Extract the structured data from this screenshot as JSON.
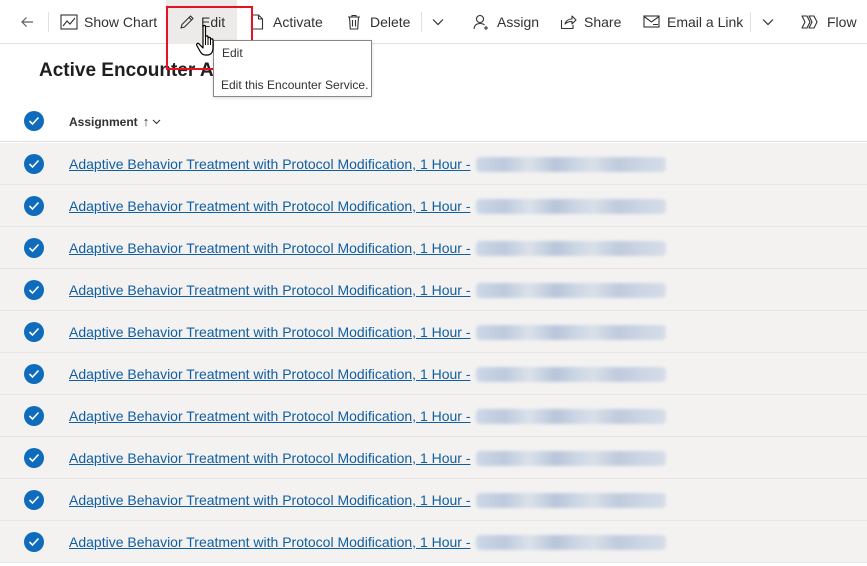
{
  "toolbar": {
    "show_chart": "Show Chart",
    "edit": "Edit",
    "activate": "Activate",
    "delete": "Delete",
    "assign": "Assign",
    "share": "Share",
    "email_link": "Email a Link",
    "flow": "Flow"
  },
  "tooltip": {
    "title": "Edit",
    "description": "Edit this Encounter Service."
  },
  "page": {
    "title": "Active Encounter A"
  },
  "grid": {
    "column_header": "Assignment",
    "sort_indicator": "↑",
    "rows": [
      {
        "label": "Adaptive Behavior Treatment with Protocol Modification, 1 Hour - "
      },
      {
        "label": "Adaptive Behavior Treatment with Protocol Modification, 1 Hour - "
      },
      {
        "label": "Adaptive Behavior Treatment with Protocol Modification, 1 Hour - "
      },
      {
        "label": "Adaptive Behavior Treatment with Protocol Modification, 1 Hour - "
      },
      {
        "label": "Adaptive Behavior Treatment with Protocol Modification, 1 Hour - "
      },
      {
        "label": "Adaptive Behavior Treatment with Protocol Modification, 1 Hour - "
      },
      {
        "label": "Adaptive Behavior Treatment with Protocol Modification, 1 Hour - "
      },
      {
        "label": "Adaptive Behavior Treatment with Protocol Modification, 1 Hour - "
      },
      {
        "label": "Adaptive Behavior Treatment with Protocol Modification, 1 Hour - "
      },
      {
        "label": "Adaptive Behavior Treatment with Protocol Modification, 1 Hour - "
      }
    ]
  },
  "colors": {
    "accent": "#0f6cbd",
    "link": "#115ea3",
    "highlight_box": "#e81123",
    "row_bg": "#f3f2f1"
  },
  "icons": [
    "back-arrow-icon",
    "chart-icon",
    "pencil-icon",
    "document-icon",
    "trash-icon",
    "chevron-down-icon",
    "person-icon",
    "share-icon",
    "email-icon",
    "flow-icon",
    "check-circle-icon",
    "hand-cursor-icon"
  ]
}
